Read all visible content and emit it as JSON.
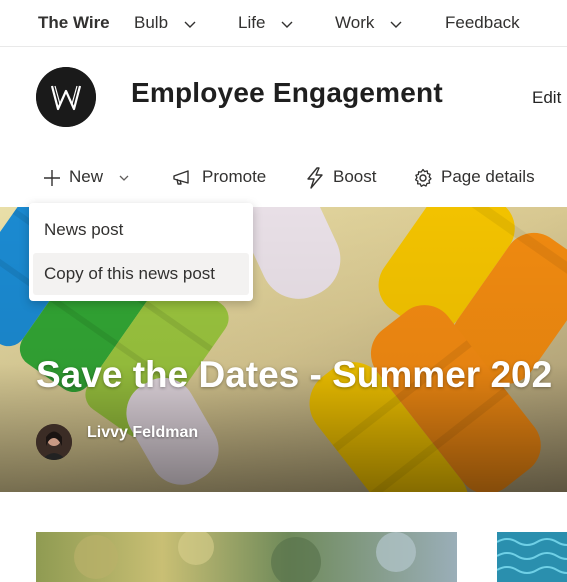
{
  "topnav": {
    "site_name": "The Wire",
    "items": [
      {
        "label": "Bulb",
        "has_menu": true
      },
      {
        "label": "Life",
        "has_menu": true
      },
      {
        "label": "Work",
        "has_menu": true
      },
      {
        "label": "Feedback",
        "has_menu": false
      }
    ]
  },
  "header": {
    "logo_letter": "W",
    "title": "Employee Engagement",
    "edit_label": "Edit"
  },
  "commandbar": {
    "new_label": "New",
    "promote_label": "Promote",
    "boost_label": "Boost",
    "page_details_label": "Page details"
  },
  "new_menu": {
    "items": [
      {
        "label": "News post"
      },
      {
        "label": "Copy of this news post"
      }
    ]
  },
  "hero": {
    "title": "Save the Dates - Summer 202",
    "author": "Livvy Feldman"
  },
  "icons": {
    "plus": "plus-icon",
    "chevron": "chevron-down-icon",
    "promote": "megaphone-icon",
    "boost": "lightning-icon",
    "page_details": "gear-icon"
  }
}
